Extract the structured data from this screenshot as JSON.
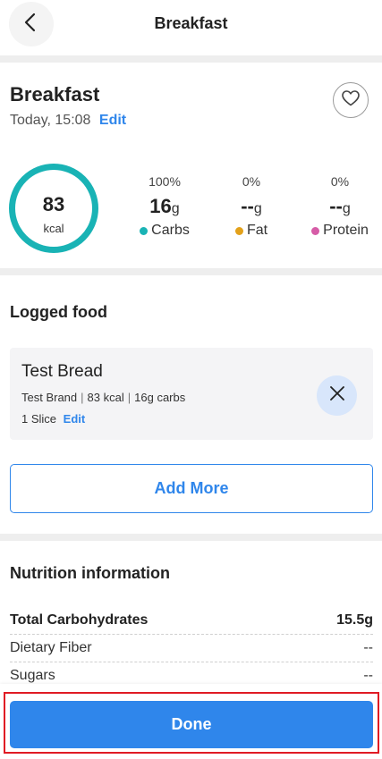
{
  "header": {
    "title": "Breakfast",
    "back_icon": "chevron-left-icon"
  },
  "meal": {
    "title": "Breakfast",
    "time": "Today, 15:08",
    "edit_label": "Edit",
    "favorite_icon": "heart-icon"
  },
  "summary": {
    "calories": "83",
    "calories_unit": "kcal",
    "ring_color": "#19b3b5",
    "macros": [
      {
        "percent": "100%",
        "amount": "16",
        "unit": "g",
        "label": "Carbs",
        "color": "#19b3b5"
      },
      {
        "percent": "0%",
        "amount": "--",
        "unit": "g",
        "label": "Fat",
        "color": "#e3a11a"
      },
      {
        "percent": "0%",
        "amount": "--",
        "unit": "g",
        "label": "Protein",
        "color": "#d65ca7"
      }
    ]
  },
  "logged_food": {
    "title": "Logged food",
    "items": [
      {
        "name": "Test Bread",
        "brand": "Test Brand",
        "calories": "83 kcal",
        "carbs": "16g carbs",
        "serving": "1 Slice",
        "edit_label": "Edit",
        "remove_icon": "close-icon"
      }
    ],
    "add_more_label": "Add More"
  },
  "nutrition": {
    "title": "Nutrition information",
    "rows": [
      {
        "label": "Total Carbohydrates",
        "value": "15.5g"
      },
      {
        "label": "Dietary Fiber",
        "value": "--"
      },
      {
        "label": "Sugars",
        "value": "--"
      }
    ]
  },
  "footer": {
    "done_label": "Done"
  },
  "colors": {
    "accent": "#2f86eb",
    "highlight": "#e01b24"
  }
}
